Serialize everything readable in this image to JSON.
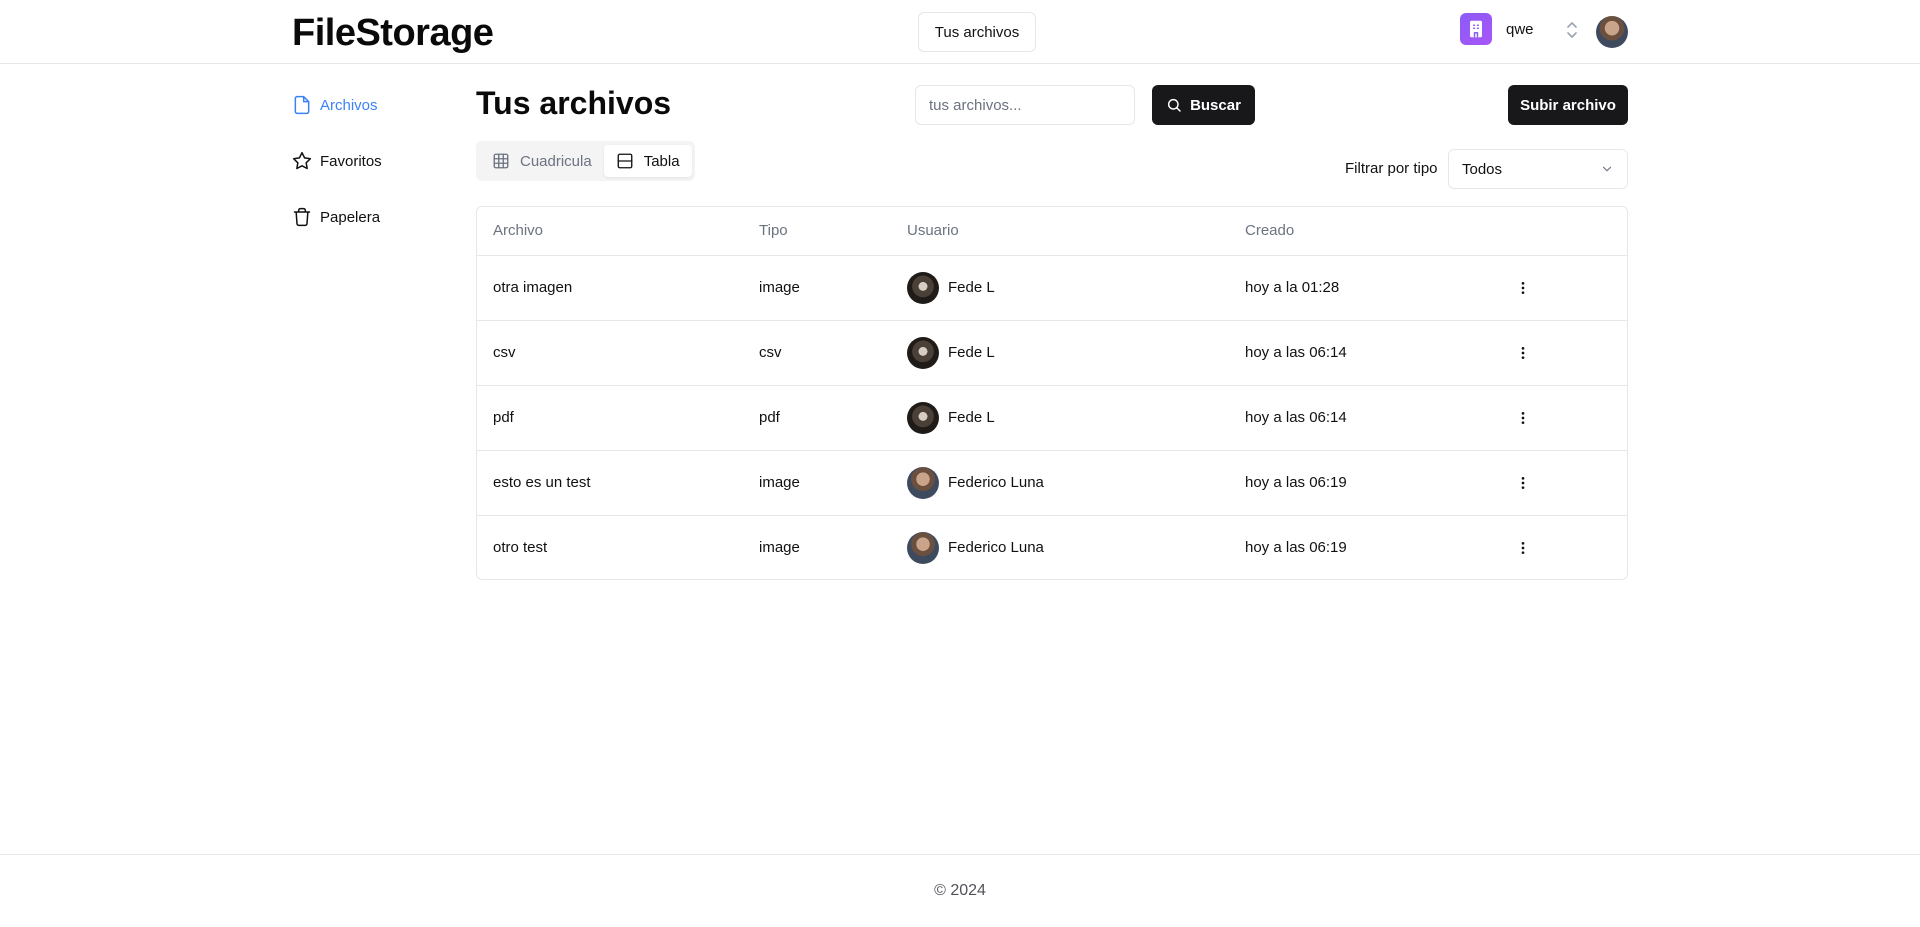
{
  "header": {
    "logo": "FileStorage",
    "nav_button": "Tus archivos",
    "org_name": "qwe"
  },
  "sidebar": {
    "items": [
      {
        "label": "Archivos",
        "icon": "file-icon",
        "active": true
      },
      {
        "label": "Favoritos",
        "icon": "star-icon",
        "active": false
      },
      {
        "label": "Papelera",
        "icon": "trash-icon",
        "active": false
      }
    ]
  },
  "main": {
    "title": "Tus archivos",
    "search_placeholder": "tus archivos...",
    "search_button": "Buscar",
    "upload_button": "Subir archivo",
    "view_tabs": [
      {
        "label": "Cuadricula",
        "icon": "grid-icon",
        "selected": false
      },
      {
        "label": "Tabla",
        "icon": "table-icon",
        "selected": true
      }
    ],
    "filter_label": "Filtrar por tipo",
    "filter_value": "Todos"
  },
  "table": {
    "columns": [
      "Archivo",
      "Tipo",
      "Usuario",
      "Creado"
    ],
    "rows": [
      {
        "file": "otra imagen",
        "type": "image",
        "user": "Fede L",
        "created": "hoy a la 01:28"
      },
      {
        "file": "csv",
        "type": "csv",
        "user": "Fede L",
        "created": "hoy a las 06:14"
      },
      {
        "file": "pdf",
        "type": "pdf",
        "user": "Fede L",
        "created": "hoy a las 06:14"
      },
      {
        "file": "esto es un test",
        "type": "image",
        "user": "Federico Luna",
        "created": "hoy a las 06:19"
      },
      {
        "file": "otro test",
        "type": "image",
        "user": "Federico Luna",
        "created": "hoy a las 06:19"
      }
    ]
  },
  "footer": {
    "text": "© 2024"
  },
  "colors": {
    "accent": "#3b82f6",
    "button_dark": "#18181b",
    "org_badge": "#8b5cf6",
    "border": "#e5e7eb"
  }
}
